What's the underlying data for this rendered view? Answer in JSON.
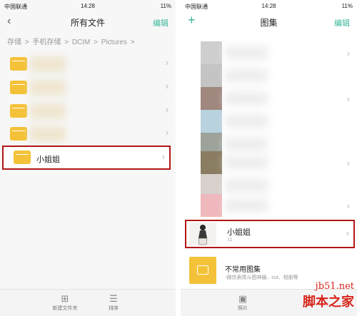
{
  "left": {
    "status": {
      "carrier": "中国联通",
      "time": "14:28",
      "battery": "11%"
    },
    "nav": {
      "back_icon": "chevron-left-icon",
      "title": "所有文件",
      "edit": "编辑"
    },
    "breadcrumb": [
      "存储",
      ">",
      "手机存储",
      ">",
      "DCIM",
      ">",
      "Pictures",
      ">"
    ],
    "highlighted_folder": "小姐姐",
    "bottombar": {
      "new_folder": "新建文件夹",
      "sort": "排序"
    }
  },
  "right": {
    "status": {
      "carrier": "中国联通",
      "time": "14:28",
      "battery": "11%"
    },
    "nav": {
      "title": "图集",
      "edit": "编辑"
    },
    "highlighted_album": {
      "label": "小姐姐",
      "count": "11"
    },
    "uncommon": {
      "label": "不常用图集",
      "sub": "-微信表情斗图神器、cut、相册等"
    },
    "bottombar": {
      "photos": "照片"
    }
  },
  "watermark": {
    "line1": "jb51.net",
    "line2": "脚本之家"
  },
  "colors": {
    "accent": "#3cb89a",
    "highlight": "#b21616",
    "folder": "#f4c238",
    "watermark": "#d7241b"
  }
}
